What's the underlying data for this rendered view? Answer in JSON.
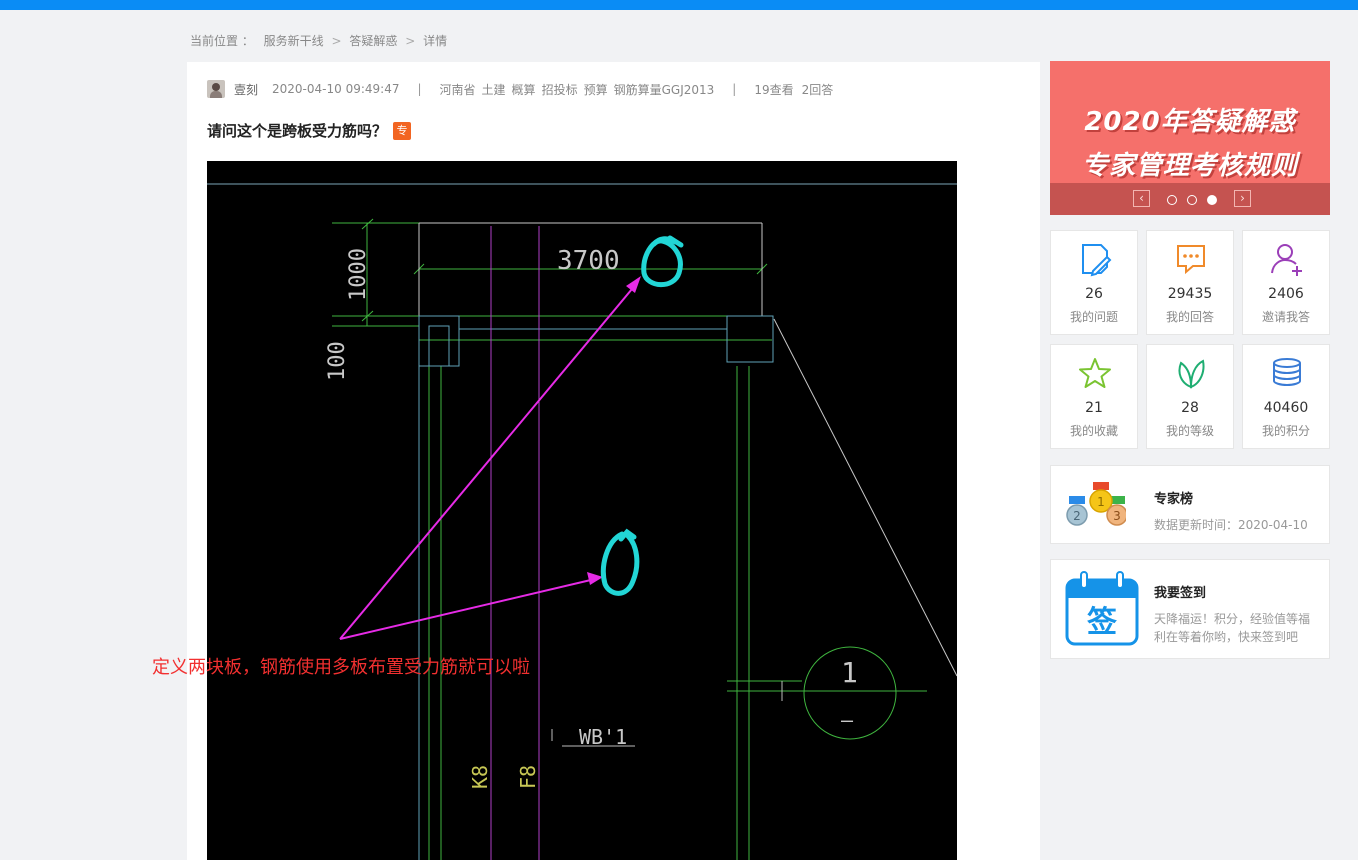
{
  "breadcrumb": {
    "prefix": "当前位置 ：",
    "items": [
      "服务新干线",
      "答疑解惑",
      "详情"
    ],
    "separator": ">"
  },
  "question": {
    "author": "壹刻",
    "date": "2020-04-10 09:49:47",
    "divider": "|",
    "tags": [
      "河南省",
      "土建",
      "概算",
      "招投标",
      "预算",
      "钢筋算量GGJ2013"
    ],
    "views": "19查看",
    "answers": "2回答",
    "title": "请问这个是跨板受力筋吗？",
    "badge": "专"
  },
  "cad_drawing": {
    "dim_width": "3700",
    "dim_height": "1000",
    "dim_small": "100",
    "section_number": "1",
    "section_dash": "–",
    "slab_label": "WB'1",
    "label_k8": "K8",
    "label_f8": "F8"
  },
  "annotation_text": "定义两块板，钢筋使用多板布置受力筋就可以啦",
  "banner": {
    "line1": "2020年答疑解惑",
    "line2": "专家管理考核规则",
    "prev": "‹",
    "next": "›",
    "slide_count": 3,
    "active_slide": 3
  },
  "stats": [
    {
      "icon": "question-edit-icon",
      "value": "26",
      "label": "我的问题",
      "color": "#1f8ff0"
    },
    {
      "icon": "chat-bubble-icon",
      "value": "29435",
      "label": "我的回答",
      "color": "#f08a2a"
    },
    {
      "icon": "add-user-icon",
      "value": "2406",
      "label": "邀请我答",
      "color": "#9b3fb8"
    },
    {
      "icon": "star-icon",
      "value": "21",
      "label": "我的收藏",
      "color": "#7ac431"
    },
    {
      "icon": "leaf-icon",
      "value": "28",
      "label": "我的等级",
      "color": "#1fae72"
    },
    {
      "icon": "coins-stack-icon",
      "value": "40460",
      "label": "我的积分",
      "color": "#3a7bd5"
    }
  ],
  "expert_board": {
    "title": "专家榜",
    "subtitle": "数据更新时间：2020-04-10",
    "medals": [
      "2",
      "1",
      "3"
    ]
  },
  "checkin": {
    "title": "我要签到",
    "desc_line1": "天降福运！积分，经验值等福",
    "desc_line2": "利在等着你哟，快来签到吧",
    "calendar_glyph": "签"
  }
}
